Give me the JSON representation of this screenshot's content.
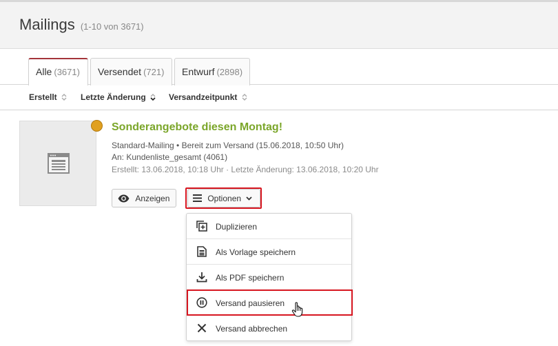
{
  "header": {
    "title": "Mailings",
    "count": "(1-10 von 3671)"
  },
  "tabs": [
    {
      "label": "Alle",
      "count": "(3671)",
      "active": true
    },
    {
      "label": "Versendet",
      "count": "(721)",
      "active": false
    },
    {
      "label": "Entwurf",
      "count": "(2898)",
      "active": false
    }
  ],
  "sort": {
    "created": "Erstellt",
    "modified": "Letzte Änderung",
    "send_time": "Versandzeitpunkt"
  },
  "mailing": {
    "status_color": "#e0a020",
    "thumbnail_icon": "newsletter-template-icon",
    "title": "Sonderangebote diesen Montag!",
    "title_color": "#7ba62a",
    "line1": "Standard-Mailing • Bereit zum Versand (15.06.2018, 10:50 Uhr)",
    "line2": "An: Kundenliste_gesamt (4061)",
    "line3": "Erstellt: 13.06.2018, 10:18 Uhr · Letzte Änderung: 13.06.2018, 10:20 Uhr"
  },
  "buttons": {
    "show": {
      "label": "Anzeigen",
      "icon": "eye-icon"
    },
    "options": {
      "label": "Optionen",
      "icon": "menu-icon"
    }
  },
  "options_menu": [
    {
      "label": "Duplizieren",
      "icon": "duplicate-icon"
    },
    {
      "label": "Als Vorlage speichern",
      "icon": "template-icon"
    },
    {
      "label": "Als PDF speichern",
      "icon": "download-icon"
    },
    {
      "label": "Versand pausieren",
      "icon": "pause-icon"
    },
    {
      "label": "Versand abbrechen",
      "icon": "cancel-icon"
    }
  ],
  "highlight_color": "#d7151f"
}
